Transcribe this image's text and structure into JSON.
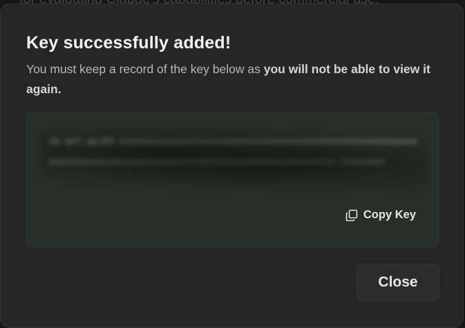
{
  "background": {
    "text": "for evaluating Claude's capabilities before commercial use."
  },
  "dialog": {
    "title": "Key successfully added!",
    "description_plain": "You must keep a record of the key below as ",
    "description_bold": "you will not be able to view it again.",
    "key_value": "sk-ant-api03-xxxxxxxxxxxxxxxxxxxxxxxxxxxxxxxxxxxxxxxxxxxxxxxxxxxxxxxxxxxxxxxxxxxxxxxxxxxxxxxxxxxxxxxxxxxxxxxxxxxxxxxxxxxx-xxxxxxxx",
    "copy_label": "Copy Key",
    "copy_icon": "copy-icon",
    "close_label": "Close"
  },
  "colors": {
    "dialog_bg": "#262626",
    "key_box_bg": "#263028",
    "title": "#f3f3f3",
    "text": "#b9b9b9"
  }
}
